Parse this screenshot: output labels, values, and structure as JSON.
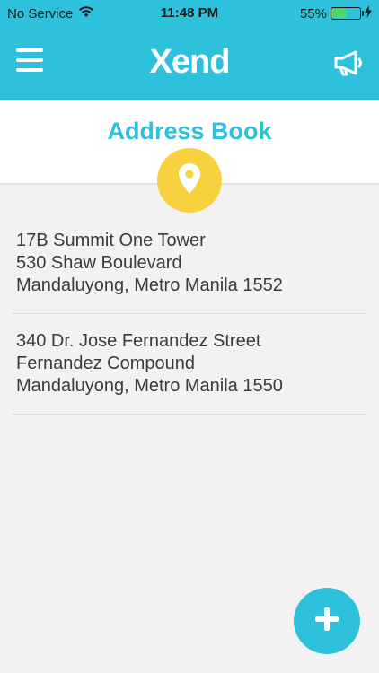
{
  "status_bar": {
    "carrier": "No Service",
    "time": "11:48 PM",
    "battery_percent": "55%",
    "battery_level": 0.55
  },
  "nav": {
    "logo_text": "Xend",
    "icons": {
      "menu": "hamburger-menu-icon",
      "announce": "megaphone-icon"
    }
  },
  "page": {
    "title": "Address Book"
  },
  "addresses": [
    {
      "line1": "17B Summit One Tower",
      "line2": "530 Shaw Boulevard",
      "line3": "Mandaluyong, Metro Manila 1552"
    },
    {
      "line1": "340 Dr. Jose Fernandez Street",
      "line2": "Fernandez Compound",
      "line3": "Mandaluyong, Metro Manila 1550"
    }
  ],
  "colors": {
    "brand": "#2ec1dc",
    "accent": "#f7d23e",
    "logo_mark": "#f5c518",
    "background": "#f2f2f2"
  }
}
